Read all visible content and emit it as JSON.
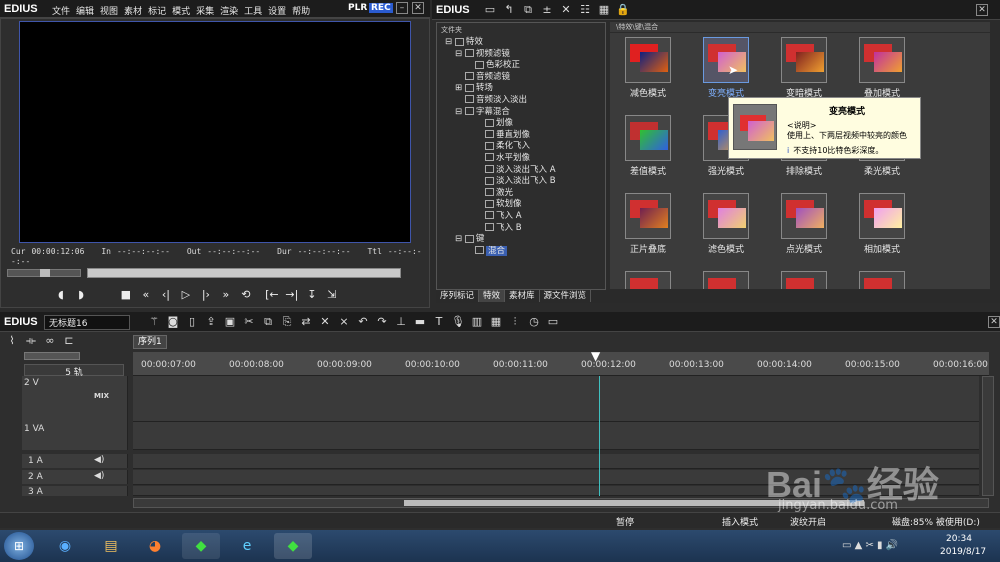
{
  "left": {
    "logo": "EDIUS",
    "menu": [
      "文件",
      "编辑",
      "视图",
      "素材",
      "标记",
      "模式",
      "采集",
      "渲染",
      "工具",
      "设置",
      "帮助"
    ],
    "plr": "PLR",
    "rec": "REC"
  },
  "timecodes": {
    "cur_label": "Cur",
    "cur": "00:00:12:06",
    "in_label": "In",
    "in": "--:--:--:--",
    "out_label": "Out",
    "out": "--:--:--:--",
    "dur_label": "Dur",
    "dur": "--:--:--:--",
    "ttl_label": "Ttl",
    "ttl": "--:--:--:--"
  },
  "right": {
    "logo": "EDIUS",
    "folder_header": "文件夹",
    "path": "\\特效\\键\\混合"
  },
  "tree": [
    "特效",
    "视频滤镜",
    "色彩校正",
    "音频滤镜",
    "转场",
    "音频淡入淡出",
    "字幕混合",
    "划像",
    "垂直划像",
    "柔化飞入",
    "水平划像",
    "淡入淡出飞入 A",
    "淡入淡出飞入 B",
    "激光",
    "软划像",
    "飞入 A",
    "飞入 B",
    "键",
    "混合"
  ],
  "effects": [
    [
      "减色模式",
      "变亮模式",
      "变暗模式",
      "叠加模式"
    ],
    [
      "差值模式",
      "强光模式",
      "排除模式",
      "柔光模式"
    ],
    [
      "正片叠底",
      "滤色模式",
      "点光模式",
      "相加模式"
    ]
  ],
  "tooltip": {
    "title": "变亮模式",
    "desc_head": "<说明>",
    "desc": "使用上、下两层视频中较亮的颜色",
    "note": "不支持10比特色彩深度。"
  },
  "right_tabs": [
    "序列标记",
    "特效",
    "素材库",
    "源文件浏览"
  ],
  "timeline": {
    "logo": "EDIUS",
    "project": "无标题16",
    "sequence_tab": "序列1",
    "track_count": "5 轨",
    "mix": "MIX",
    "ruler": [
      "00:00:07:00",
      "00:00:08:00",
      "00:00:09:00",
      "00:00:10:00",
      "00:00:11:00",
      "00:00:12:00",
      "00:00:13:00",
      "00:00:14:00",
      "00:00:15:00",
      "00:00:16:00"
    ],
    "tracks": [
      "2 V",
      "1 VA",
      "1 A",
      "2 A",
      "3 A"
    ]
  },
  "status": {
    "pause": "暂停",
    "insert": "插入模式",
    "ripple": "波纹开启",
    "disk": "磁盘:85% 被使用(D:)"
  },
  "taskbar": {
    "time": "20:34",
    "date": "2019/8/17"
  },
  "watermark": {
    "site": "jingyan.baidu.com"
  }
}
